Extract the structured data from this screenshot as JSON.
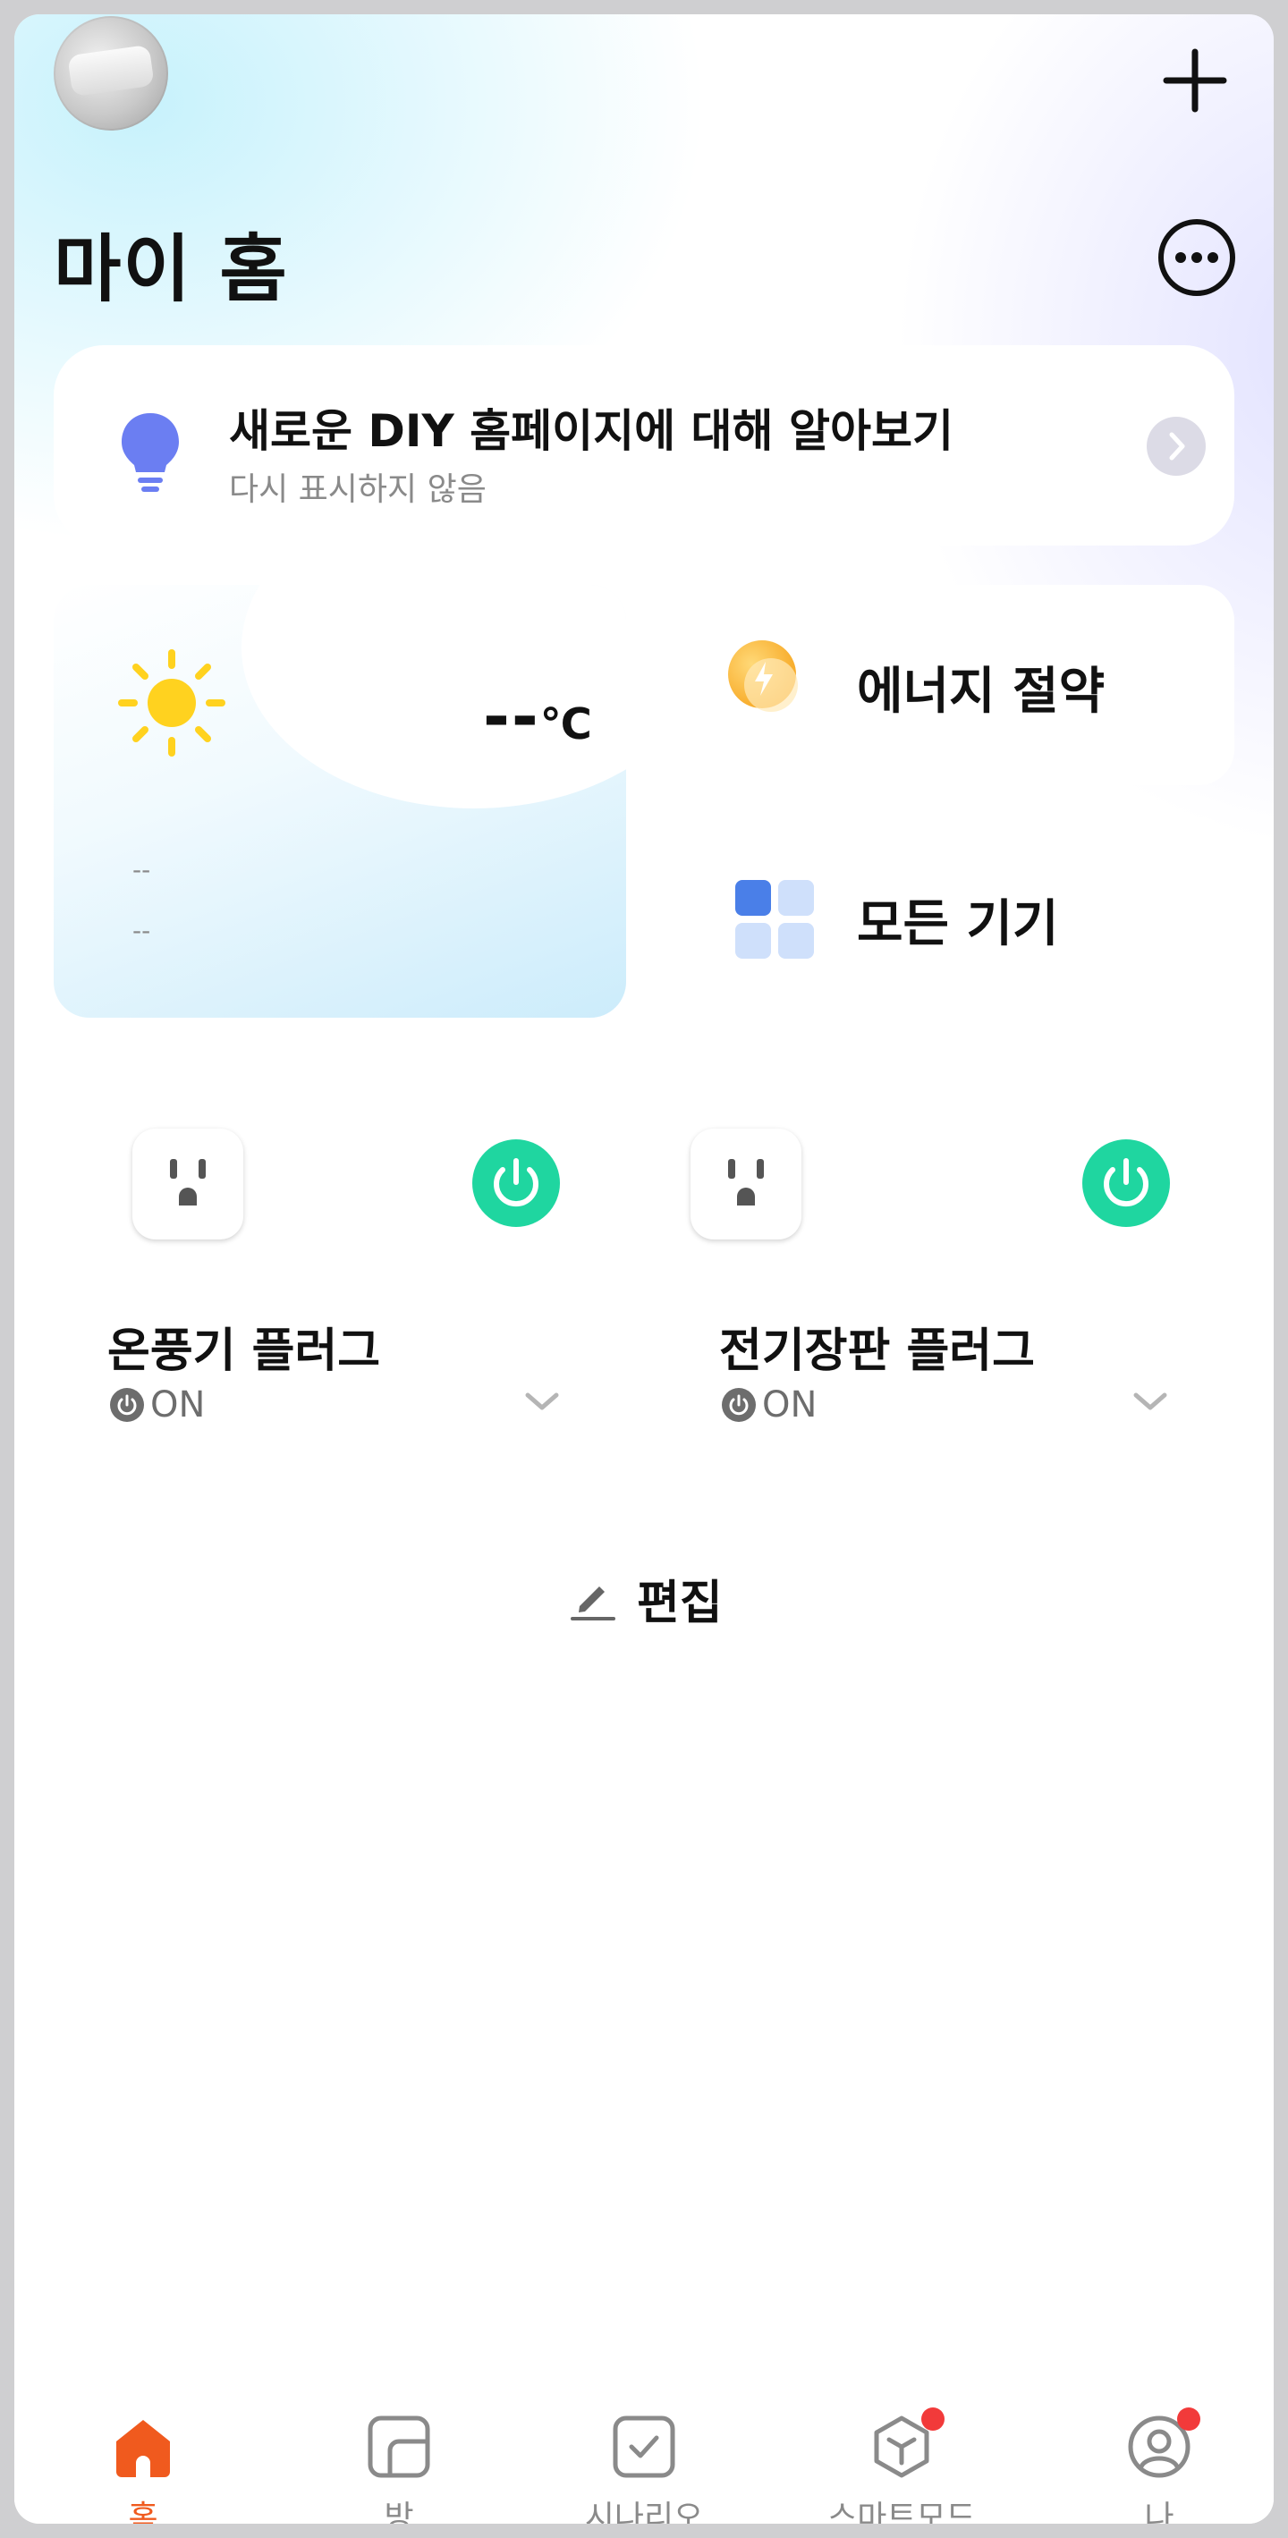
{
  "header": {
    "title": "마이 홈"
  },
  "banner": {
    "title": "새로운 DIY 홈페이지에 대해 알아보기",
    "subtitle": "다시 표시하지 않음"
  },
  "weather": {
    "temperature": "--",
    "unit": "℃",
    "line1": "--",
    "line2": "--"
  },
  "shortcuts": {
    "energy_label": "에너지 절약",
    "devices_label": "모든 기기"
  },
  "plugs": [
    {
      "name": "온풍기 플러그",
      "status": "ON"
    },
    {
      "name": "전기장판 플러그",
      "status": "ON"
    }
  ],
  "edit_label": "편집",
  "tabs": [
    {
      "label": "홈",
      "active": true
    },
    {
      "label": "방",
      "active": false
    },
    {
      "label": "시나리오",
      "active": false
    },
    {
      "label": "스마트모드",
      "active": false,
      "badge": true
    },
    {
      "label": "나",
      "active": false,
      "badge": true
    }
  ],
  "colors": {
    "accent": "#f05a1e",
    "power_on": "#1fd6a0",
    "badge": "#f23a3a",
    "bulb": "#6b7ef2"
  }
}
